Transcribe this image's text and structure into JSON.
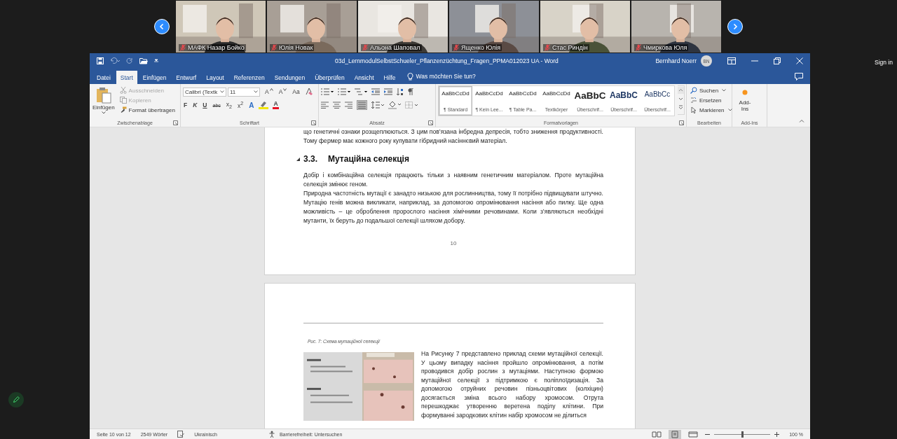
{
  "meeting": {
    "participants": [
      {
        "name": "МАФК Назар Бойко",
        "muted": true,
        "kind": "picture"
      },
      {
        "name": "Юлія Новак",
        "muted": true,
        "kind": "picture"
      },
      {
        "name": "Альона Шаповал",
        "muted": true,
        "kind": "picture"
      },
      {
        "name": "Ященко Юлія",
        "muted": true,
        "kind": "picture"
      },
      {
        "name": "Стас Риндін",
        "muted": true,
        "kind": "picture"
      },
      {
        "name": "Чмиркова Юля",
        "muted": true,
        "kind": "picture"
      }
    ],
    "sign_in": "Sign in"
  },
  "word": {
    "title": "03d_LernmodulSelbstSchueler_Pflanzenzüchtung_Fragen_PPMA012023  UA  -  Word",
    "user": "Bernhard Noerr",
    "initials": "BN",
    "tabs": [
      {
        "label": "Datei",
        "selected": false
      },
      {
        "label": "Start",
        "selected": true
      },
      {
        "label": "Einfügen",
        "selected": false
      },
      {
        "label": "Entwurf",
        "selected": false
      },
      {
        "label": "Layout",
        "selected": false
      },
      {
        "label": "Referenzen",
        "selected": false
      },
      {
        "label": "Sendungen",
        "selected": false
      },
      {
        "label": "Überprüfen",
        "selected": false
      },
      {
        "label": "Ansicht",
        "selected": false
      },
      {
        "label": "Hilfe",
        "selected": false
      }
    ],
    "tell_me": "Was möchten Sie tun?",
    "clipboard": {
      "group": "Zwischenablage",
      "paste": "Einfügen",
      "items": [
        {
          "label": "Ausschneiden",
          "disabled": true,
          "kind": "cut"
        },
        {
          "label": "Kopieren",
          "disabled": true,
          "kind": "copy"
        },
        {
          "label": "Format übertragen",
          "disabled": false,
          "kind": "painter"
        }
      ]
    },
    "font": {
      "group": "Schriftart",
      "family": "Calibri (Textk",
      "size": "11",
      "row1": [
        {
          "label": "A",
          "kind": "grow"
        },
        {
          "label": "A",
          "kind": "shrink"
        },
        {
          "label": "Aa",
          "kind": "case"
        }
      ],
      "row2": [
        {
          "label": "F",
          "kind": "bold"
        },
        {
          "label": "K",
          "kind": "italic"
        },
        {
          "label": "U",
          "kind": "underline"
        },
        {
          "label": "abc",
          "kind": "strike"
        },
        {
          "label": "x$_{2}$",
          "kind": "script"
        },
        {
          "label": "x$^{2}$",
          "kind": "script"
        },
        {
          "label": "A",
          "kind": "effects"
        },
        {
          "label": "A",
          "kind": "color"
        }
      ]
    },
    "paragraph": {
      "group": "Absatz"
    },
    "styles": {
      "group": "Formatvorlagen",
      "items": [
        {
          "preview": "AaBbCcDd",
          "name": "¶ Standard",
          "kind": "body",
          "selected": true
        },
        {
          "preview": "AaBbCcDd",
          "name": "¶ Kein Lee...",
          "kind": "body",
          "selected": false
        },
        {
          "preview": "AaBbCcDd",
          "name": "¶ Table Pa...",
          "kind": "body",
          "selected": false
        },
        {
          "preview": "AaBbCcDd",
          "name": "Textkörper",
          "kind": "body",
          "selected": false
        },
        {
          "preview": "AaBbC",
          "name": "Überschrif...",
          "kind": "heading1",
          "selected": false
        },
        {
          "preview": "AaBbC",
          "name": "Überschrif...",
          "kind": "heading2",
          "selected": false
        },
        {
          "preview": "AaBbCc",
          "name": "Überschrif...",
          "kind": "heading3",
          "selected": false
        }
      ]
    },
    "editing": {
      "group": "Bearbeiten",
      "items": [
        {
          "label": "Suchen",
          "kind": "search"
        },
        {
          "label": "Ersetzen",
          "kind": "replace"
        },
        {
          "label": "Markieren",
          "kind": "select"
        }
      ]
    },
    "addins": {
      "group": "Add-Ins",
      "button": "Add-Ins"
    },
    "page_1": {
      "blocks": [
        {
          "kind": "paragraph",
          "text": "що генетичні ознаки розщеплюються. З цим пов’язана інбредна депресія, тобто зниження продуктивності. Тому фермер має кожного року купувати гібридний насіннєвий матеріал."
        },
        {
          "kind": "heading",
          "number": "3.3.",
          "text": "Мутаційна селекція"
        },
        {
          "kind": "paragraph",
          "text": "Добір і комбінаційна селекція працюють тільки з наявним генетичним матеріалом. Проте мутаційна селекція змінює геном."
        },
        {
          "kind": "paragraph",
          "text": "Природна частотність мутації є занадто низькою для рослинництва, тому її потрібно підвищувати штучно. Мутацію генів можна викликати, наприклад, за допомогою опромінювання насіння або пилку. Ще одна можливість – це оброблення пророслого насіння хімічними речовинами. Коли з’являються необхідні мутанти, їх беруть до подальшої селекції шляхом добору."
        }
      ],
      "page_number": "10"
    },
    "page_2": {
      "caption": "Рис. 7: Схема мутаційної селекції",
      "text": "На Рисунку 7 представлено приклад схеми мутаційної селекції. У цьому випадку насіння пройшло опромінювання, а потім проводився добір рослин з мутаціями. Наступною формою мутаційної селекції з підтримкою є поліплоїдизація. За допомогою отруйних речовин пізньоцвітових (колхіцин) досягається зміна всього набору хромосом. Отрута перешкоджає утворенню веретена поділу клітини. При формуванні зародкових клітин набір хромосом не ділиться"
    },
    "status": {
      "page": "Seite 10 von 12",
      "words": "2549 Wörter",
      "language": "Ukrainisch",
      "accessibility": "Barrierefreiheit: Untersuchen",
      "views": [
        {
          "kind": "read",
          "selected": false
        },
        {
          "kind": "print",
          "selected": true
        },
        {
          "kind": "web",
          "selected": false
        }
      ],
      "zoom": {
        "level": 0.5,
        "label": "100 %"
      }
    }
  }
}
